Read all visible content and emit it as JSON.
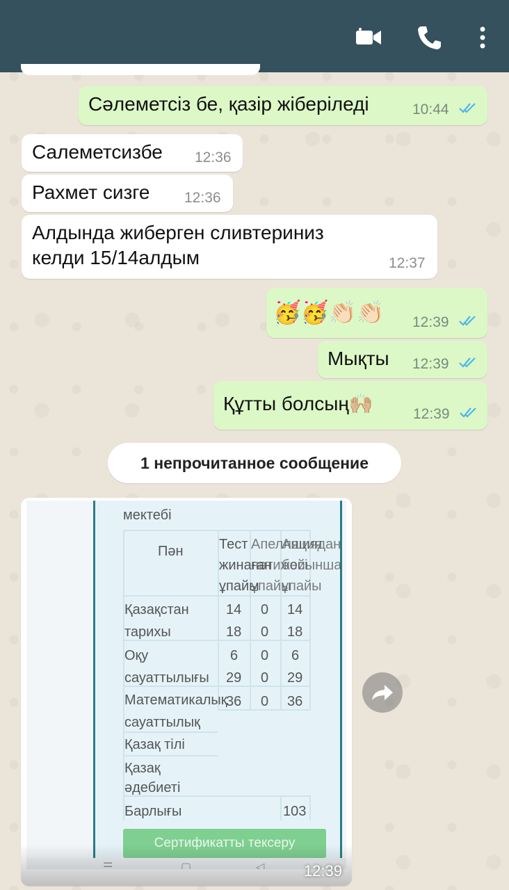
{
  "header": {
    "icons": [
      "video-call-icon",
      "voice-call-icon",
      "more-options-icon"
    ],
    "bg_color": "#34515d"
  },
  "messages": [
    {
      "dir": "out",
      "text": "Сәлеметсіз бе, қазір жіберіледі",
      "time": "10:44",
      "status": "read"
    },
    {
      "dir": "in",
      "text": "Салеметсизбе",
      "time": "12:36"
    },
    {
      "dir": "in",
      "text": "Рахмет сизге",
      "time": "12:36"
    },
    {
      "dir": "in",
      "text_line1": "Алдында жиберген сливтериниз",
      "text_line2": "келди 15/14алдым",
      "time": "12:37"
    },
    {
      "dir": "out",
      "text": "🥳🥳👏🏻👏🏻",
      "time": "12:39",
      "status": "read"
    },
    {
      "dir": "out",
      "text": "Мықты",
      "time": "12:39",
      "status": "read"
    },
    {
      "dir": "out",
      "text": "Құтты болсың🙌🏼",
      "time": "12:39",
      "status": "read"
    }
  ],
  "unread_banner": "1 непрочитанное сообщение",
  "image_message": {
    "time": "12:39",
    "doc": {
      "school": "мектебі",
      "header_subject": "Пән",
      "header_col1": "Тест",
      "header_col1b": "жинаған",
      "header_col1c": "ұпайы",
      "header_col2": "Апелляция",
      "header_col2b": "нәтижесі",
      "header_col2c": "ұпайы",
      "header_col3": "Ашиядан",
      "header_col3b": "бойынша",
      "header_col3c": "ұпайы",
      "rows": [
        {
          "name1": "Қазақстан",
          "name2": "тарихы",
          "v1": "14",
          "v2": "0",
          "v3": "14",
          "v1b": "18",
          "v2b": "0",
          "v3b": "18"
        },
        {
          "name1": "Оқу",
          "name2": "сауаттылығы",
          "v1": "6",
          "v2": "0",
          "v3": "6",
          "v1b": "29",
          "v2b": "0",
          "v3b": "29"
        },
        {
          "name1": "Математикалық",
          "name2": "сауаттылық",
          "v1": "36",
          "v2": "0",
          "v3": "36"
        }
      ],
      "row_kazakh": "Қазақ тілі",
      "row_lit1": "Қазақ",
      "row_lit2": "әдебиеті",
      "row_total": "Барлығы",
      "total_value": "103",
      "button": "Сертификатты тексеру"
    }
  },
  "colors": {
    "outgoing": "#dcf8c6",
    "incoming": "#ffffff",
    "read_ticks": "#4fb6ec"
  }
}
